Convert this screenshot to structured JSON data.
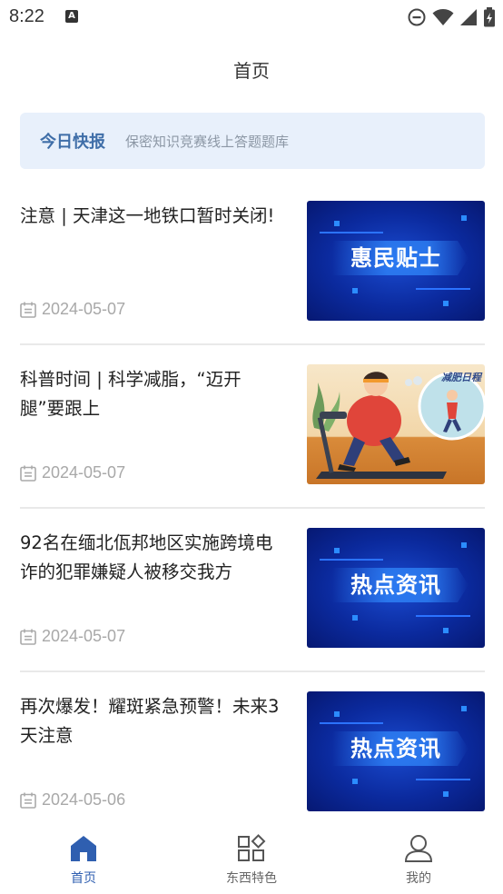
{
  "status_bar": {
    "time": "8:22",
    "notification_icon": "A"
  },
  "header": {
    "title": "首页"
  },
  "banner": {
    "tag": "今日快报",
    "text": "保密知识竞赛线上答题题库"
  },
  "news": [
    {
      "title": "注意 | 天津这一地铁口暂时关闭!",
      "date": "2024-05-07",
      "thumb_text": "惠民贴士"
    },
    {
      "title": "科普时间 | 科学减脂，“迈开腿”要跟上",
      "date": "2024-05-07",
      "thumb_text": "减肥日程"
    },
    {
      "title": "92名在缅北佤邦地区实施跨境电诈的犯罪嫌疑人被移交我方",
      "date": "2024-05-07",
      "thumb_text": "热点资讯"
    },
    {
      "title": "再次爆发！耀斑紧急预警！未来3天注意",
      "date": "2024-05-06",
      "thumb_text": "热点资讯"
    }
  ],
  "tabbar": {
    "home": "首页",
    "feature": "东西特色",
    "mine": "我的"
  },
  "colors": {
    "accent": "#2f5fb0",
    "banner_bg": "#e8f0fb",
    "thumb_blue": "#0b2a9e"
  }
}
